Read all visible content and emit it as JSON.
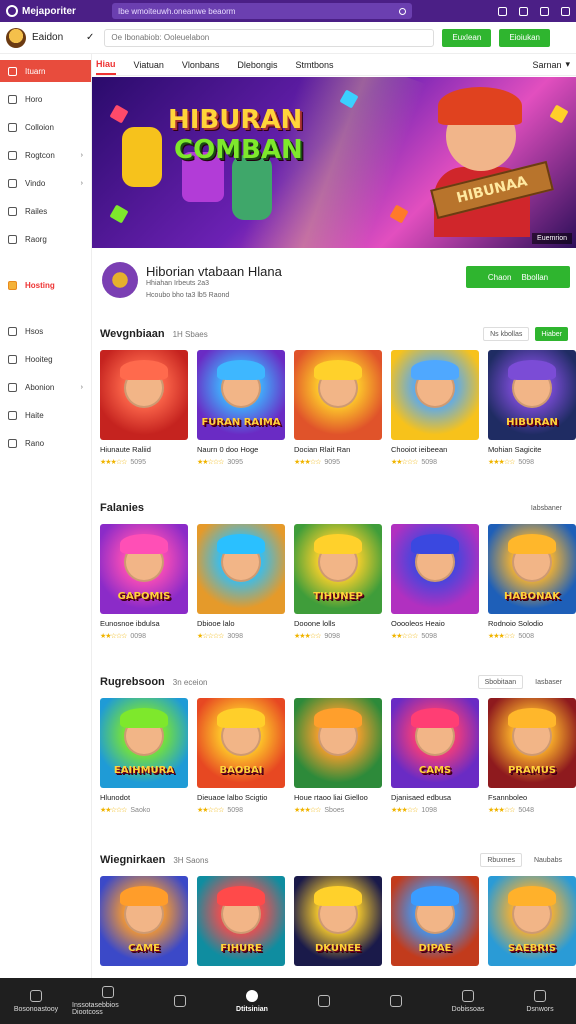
{
  "topbar": {
    "title": "Mejaporiter",
    "url": "Ibe wmoiteuwh.oneanwe beaorm"
  },
  "header": {
    "username": "Eaidon",
    "search_placeholder": "Oe Ibonabiob: Ooleuelabon",
    "btn1": "Euxlean",
    "btn2": "Eioiukan"
  },
  "tabs": [
    {
      "label": "Hiau",
      "active": true
    },
    {
      "label": "Viatuan",
      "active": false
    },
    {
      "label": "Vlonbans",
      "active": false
    },
    {
      "label": "Dlebongis",
      "active": false
    },
    {
      "label": "Stmtbons",
      "active": false
    }
  ],
  "sort_label": "Sarnan",
  "sidebar": [
    {
      "label": "Ituarn",
      "icon": "home-icon",
      "active": true,
      "arrow": false
    },
    {
      "label": "Horo",
      "icon": "game-icon",
      "arrow": false
    },
    {
      "label": "Colloion",
      "icon": "puzzle-icon",
      "arrow": false
    },
    {
      "label": "Rogtcon",
      "icon": "grid-icon",
      "arrow": true
    },
    {
      "label": "Vindo",
      "icon": "play-icon",
      "arrow": true
    },
    {
      "label": "Railes",
      "icon": "tag-icon",
      "arrow": false
    },
    {
      "label": "Raorg",
      "icon": "folder-icon",
      "arrow": false
    },
    {
      "label": "",
      "icon": "",
      "spacer": true
    },
    {
      "label": "Hosting",
      "icon": "fire-icon",
      "hot": true
    },
    {
      "label": "",
      "icon": "",
      "spacer": true
    },
    {
      "label": "Hsos",
      "icon": "list-icon"
    },
    {
      "label": "Hooiteg",
      "icon": "calendar-icon"
    },
    {
      "label": "Abonion",
      "icon": "clock-icon",
      "arrow": true
    },
    {
      "label": "Haite",
      "icon": "heart-icon"
    },
    {
      "label": "Rano",
      "icon": "settings-icon"
    }
  ],
  "banner": {
    "line1": "HIBURAN",
    "line2": "COMBAN",
    "sign": "HIBUNAA",
    "badge": "Euemrion"
  },
  "game": {
    "title": "Hiborian vtabaan Hlana",
    "sub1": "Hhiahan Irbeuts 2a3",
    "sub2": "Hcoubo bho ta3 lb5 Raond",
    "play_left": "Chaon",
    "play_right": "Bbollan"
  },
  "sections": [
    {
      "title": "Wevgnbiaan",
      "count": "1H Sbaes",
      "btn": "Ns kbollas",
      "btn2": "Hiaber",
      "btn2_green": true,
      "cards": [
        {
          "name": "Hiunaute Raliid",
          "rating": "5095",
          "stars": "★★★☆☆",
          "word": "",
          "bg": "#c5231f",
          "acc": "#ff6a4d"
        },
        {
          "name": "Naurn 0 doo Hoge",
          "rating": "3095",
          "stars": "★★☆☆☆",
          "word": "FURAN RAIMA",
          "bg": "#6a2bc4",
          "acc": "#3eb7ff"
        },
        {
          "name": "Docian Rlait Ran",
          "rating": "9095",
          "stars": "★★★☆☆",
          "word": "",
          "bg": "#e0532a",
          "acc": "#ffd12b"
        },
        {
          "name": "Chooiot ieibeean",
          "rating": "5098",
          "stars": "★★☆☆☆",
          "word": "",
          "bg": "#f7c21b",
          "acc": "#4fa8ff"
        },
        {
          "name": "Mohian Sagicite",
          "rating": "5098",
          "stars": "★★★☆☆",
          "word": "HIBURAN",
          "bg": "#1f2c63",
          "acc": "#7b4cd6"
        }
      ]
    },
    {
      "title": "Falanies",
      "count": "",
      "btn": "",
      "btn2": "Iabsbaner",
      "btn2_green": false,
      "cards": [
        {
          "name": "Eunosnoe ibdulsa",
          "rating": "0098",
          "stars": "★★☆☆☆",
          "word": "GAPOMIS",
          "bg": "#8b2bc8",
          "acc": "#ff4fb6"
        },
        {
          "name": "Dbiooe lalo",
          "rating": "3098",
          "stars": "★☆☆☆☆",
          "word": "",
          "bg": "#e59a2a",
          "acc": "#2ac0ff"
        },
        {
          "name": "Dooone lolls",
          "rating": "9098",
          "stars": "★★★☆☆",
          "word": "TIHUNEP",
          "bg": "#3f9d3a",
          "acc": "#ffd12b"
        },
        {
          "name": "Ooooleos Heaio",
          "rating": "5098",
          "stars": "★★☆☆☆",
          "word": "",
          "bg": "#b130c0",
          "acc": "#3a48e0"
        },
        {
          "name": "Rodnoio Solodio",
          "rating": "5008",
          "stars": "★★★☆☆",
          "word": "HABONAK",
          "bg": "#1e5fb8",
          "acc": "#ffb72b"
        }
      ]
    },
    {
      "title": "Rugrebsoon",
      "count": "3n eceion",
      "btn": "Sbobitaan",
      "btn2": "Iasbaser",
      "btn2_green": false,
      "cards": [
        {
          "name": "Hlunodot",
          "rating": "Saoko",
          "stars": "★★☆☆☆",
          "word": "EAIHMURA",
          "bg": "#1f9bd6",
          "acc": "#7ee82c"
        },
        {
          "name": "Dieuaoe lalbo Scigtio",
          "rating": "5098",
          "stars": "★★☆☆☆",
          "word": "BAOBAI",
          "bg": "#e74822",
          "acc": "#ffcf2a"
        },
        {
          "name": "Houe rtaoo liai Gielloo",
          "rating": "Sboes",
          "stars": "★★★☆☆",
          "word": "",
          "bg": "#2d8a3a",
          "acc": "#ff9f2c"
        },
        {
          "name": "Djanisaed edbusa",
          "rating": "1098",
          "stars": "★★★☆☆",
          "word": "CAMS",
          "bg": "#6a2bc4",
          "acc": "#ff3e74"
        },
        {
          "name": "Fsannboleo",
          "rating": "5048",
          "stars": "★★★☆☆",
          "word": "PRAMUS",
          "bg": "#8e1a1e",
          "acc": "#ffb72b"
        }
      ]
    },
    {
      "title": "Wiegnirkaen",
      "count": "3H Saons",
      "btn": "Rbuxnes",
      "btn2": "Naubabs",
      "btn2_green": false,
      "cards": [
        {
          "name": "",
          "rating": "",
          "stars": "",
          "word": "CAME",
          "bg": "#3b49c8",
          "acc": "#ff9d2a"
        },
        {
          "name": "",
          "rating": "",
          "stars": "",
          "word": "FIHURE",
          "bg": "#0f8da0",
          "acc": "#ff4a4a"
        },
        {
          "name": "",
          "rating": "",
          "stars": "",
          "word": "DKUNEE",
          "bg": "#1a1a4a",
          "acc": "#ffd12b"
        },
        {
          "name": "",
          "rating": "",
          "stars": "",
          "word": "DIPAE",
          "bg": "#c23b1c",
          "acc": "#3a9cff"
        },
        {
          "name": "",
          "rating": "",
          "stars": "",
          "word": "SAEBRIS",
          "bg": "#2a9bd6",
          "acc": "#ffb12b"
        }
      ]
    }
  ],
  "bottomnav": [
    {
      "label": "Bosonoastooy",
      "icon": "home-icon"
    },
    {
      "label": "Inssotasebbios Diootcoss",
      "icon": "trophy-icon"
    },
    {
      "label": "",
      "icon": "image-icon"
    },
    {
      "label": "Dtitsinian",
      "icon": "circle-icon",
      "active": true
    },
    {
      "label": "",
      "icon": "message-icon"
    },
    {
      "label": "",
      "icon": "search-icon"
    },
    {
      "label": "Dobissoas",
      "icon": "settings-icon"
    },
    {
      "label": "Dsnwors",
      "icon": "person-icon"
    }
  ]
}
